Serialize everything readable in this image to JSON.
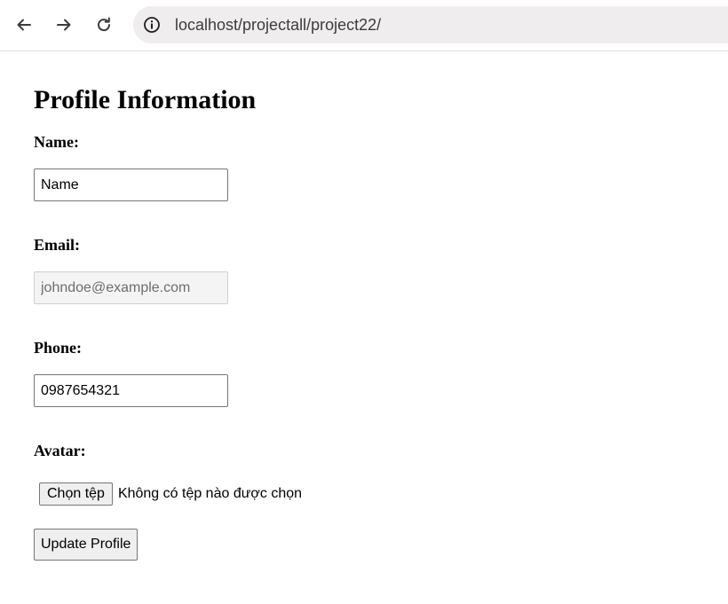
{
  "browser": {
    "url": "localhost/projectall/project22/",
    "icons": {
      "back": "arrow-left-icon",
      "forward": "arrow-right-icon",
      "reload": "reload-icon",
      "site_info": "info-icon"
    }
  },
  "profile": {
    "title": "Profile Information",
    "name_label": "Name:",
    "name_value": "Name",
    "email_label": "Email:",
    "email_value": "johndoe@example.com",
    "phone_label": "Phone:",
    "phone_value": "0987654321",
    "avatar_label": "Avatar:",
    "file_button_label": "Chọn tệp",
    "file_status": "Không có tệp nào được chọn",
    "submit_label": "Update Profile"
  }
}
